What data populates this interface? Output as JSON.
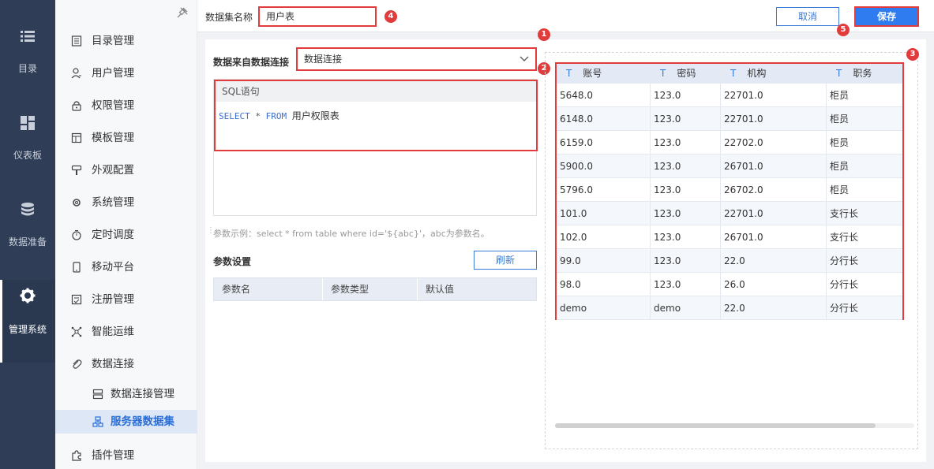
{
  "rail": [
    {
      "icon": "list-icon",
      "label": "目录"
    },
    {
      "icon": "dashboard-icon",
      "label": "仪表板"
    },
    {
      "icon": "database-icon",
      "label": "数据准备"
    },
    {
      "icon": "gear-icon",
      "label": "管理系统"
    }
  ],
  "nav": [
    {
      "icon": "catalog-icon",
      "label": "目录管理"
    },
    {
      "icon": "user-icon",
      "label": "用户管理"
    },
    {
      "icon": "lock-icon",
      "label": "权限管理"
    },
    {
      "icon": "template-icon",
      "label": "模板管理"
    },
    {
      "icon": "brush-icon",
      "label": "外观配置"
    },
    {
      "icon": "gear-icon",
      "label": "系统管理"
    },
    {
      "icon": "timer-icon",
      "label": "定时调度"
    },
    {
      "icon": "mobile-icon",
      "label": "移动平台"
    },
    {
      "icon": "register-icon",
      "label": "注册管理"
    },
    {
      "icon": "ops-icon",
      "label": "智能运维"
    },
    {
      "icon": "link-icon",
      "label": "数据连接"
    },
    {
      "icon": "server-icon",
      "label": "数据连接管理"
    },
    {
      "icon": "dataset-icon",
      "label": "服务器数据集"
    },
    {
      "icon": "plugin-icon",
      "label": "插件管理"
    }
  ],
  "header": {
    "dataset_name_label": "数据集名称",
    "dataset_name_value": "用户表",
    "cancel_label": "取消",
    "save_label": "保存"
  },
  "badges": [
    "1",
    "2",
    "3",
    "4",
    "5"
  ],
  "source": {
    "label": "数据来自数据连接",
    "selected": "数据连接"
  },
  "sql": {
    "header": "SQL语句",
    "kw_select": "SELECT",
    "star": "*",
    "kw_from": "FROM",
    "table": "用户权限表"
  },
  "hint": "参数示例：select * from table where id='${abc}'，abc为参数名。",
  "params": {
    "title": "参数设置",
    "refresh_label": "刷新",
    "columns": [
      "参数名",
      "参数类型",
      "默认值"
    ]
  },
  "preview": {
    "type_glyph": "T",
    "columns": [
      "账号",
      "密码",
      "机构",
      "职务"
    ],
    "rows": [
      [
        "5648.0",
        "123.0",
        "22701.0",
        "柜员"
      ],
      [
        "6148.0",
        "123.0",
        "22701.0",
        "柜员"
      ],
      [
        "6159.0",
        "123.0",
        "22702.0",
        "柜员"
      ],
      [
        "5900.0",
        "123.0",
        "26701.0",
        "柜员"
      ],
      [
        "5796.0",
        "123.0",
        "26702.0",
        "柜员"
      ],
      [
        "101.0",
        "123.0",
        "22701.0",
        "支行长"
      ],
      [
        "102.0",
        "123.0",
        "26701.0",
        "支行长"
      ],
      [
        "99.0",
        "123.0",
        "22.0",
        "分行长"
      ],
      [
        "98.0",
        "123.0",
        "26.0",
        "分行长"
      ],
      [
        "demo",
        "demo",
        "22.0",
        "分行长"
      ]
    ]
  },
  "colors": {
    "rail_bg": "#2f3e56",
    "accent": "#2f7cf1",
    "highlight": "#e23b3b",
    "selected_bg": "#dde7f6"
  }
}
